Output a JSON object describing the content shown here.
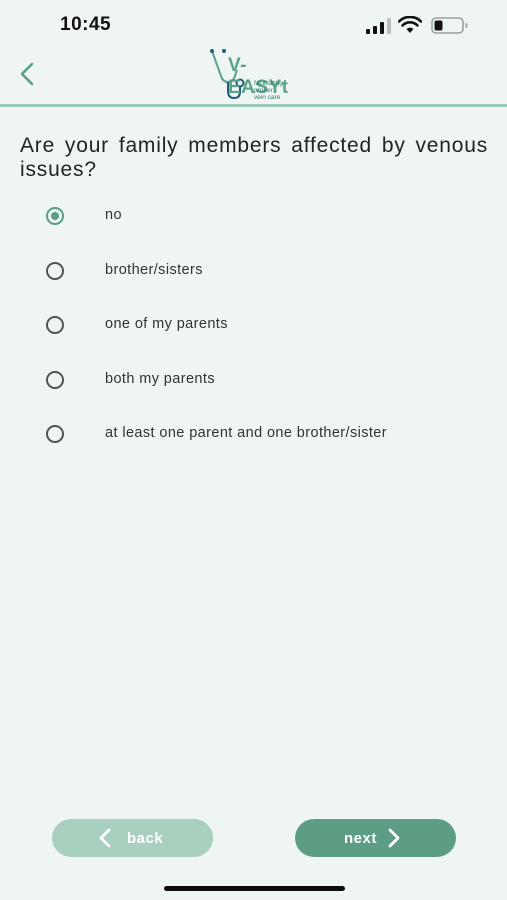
{
  "status_bar": {
    "time": "10:45",
    "icons": [
      "cellular-signal-icon",
      "wifi-icon",
      "battery-icon"
    ]
  },
  "header": {
    "back_icon": "chevron-left-icon",
    "logo": {
      "name": "V-EASYt",
      "tagline_lines": [
        "facilitating",
        "proper",
        "vein care"
      ]
    }
  },
  "question": {
    "text": "Are your family members affected by venous issues?"
  },
  "options": [
    {
      "label": "no",
      "selected": true
    },
    {
      "label": "brother/sisters",
      "selected": false
    },
    {
      "label": "one of my parents",
      "selected": false
    },
    {
      "label": "both my parents",
      "selected": false
    },
    {
      "label": "at least one parent and one brother/sister",
      "selected": false
    }
  ],
  "footer": {
    "back_label": "back",
    "next_label": "next"
  },
  "colors": {
    "background": "#eff5f2",
    "accent": "#5d9d84",
    "accent_light": "#a9cfbf",
    "divider": "#9cc9b7"
  }
}
